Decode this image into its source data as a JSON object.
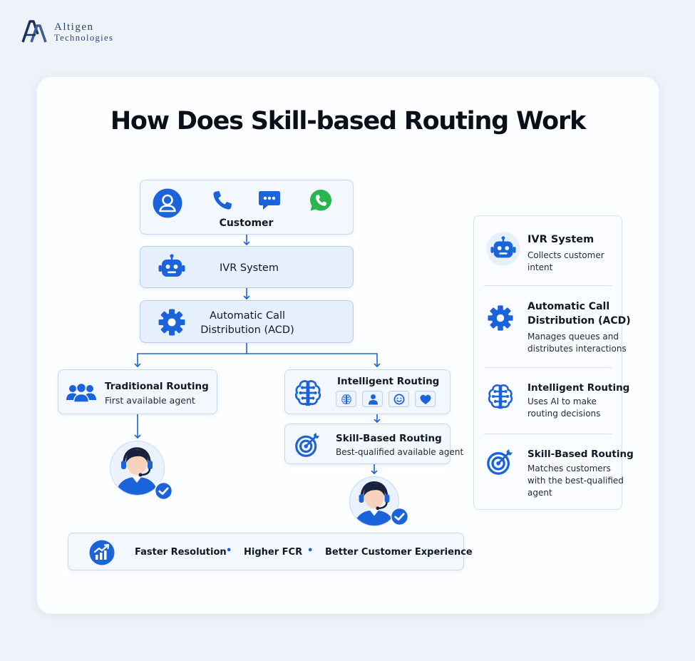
{
  "logo": {
    "line1": "Altigen",
    "line2": "Technologies"
  },
  "title": "How Does Skill-based Routing Work",
  "diagram": {
    "customer": {
      "label": "Customer",
      "icons": [
        "user-icon",
        "phone-icon",
        "chat-icon",
        "whatsapp-icon"
      ]
    },
    "ivr": {
      "label": "IVR System",
      "icon": "robot-icon"
    },
    "acd": {
      "line1": "Automatic Call",
      "line2": "Distribution (ACD)",
      "icon": "gear-icon"
    },
    "traditional": {
      "title": "Traditional Routing",
      "subtitle": "First available agent",
      "icon": "team-icon"
    },
    "intelligent": {
      "title": "Intelligent Routing",
      "icon": "brain-icon",
      "chips": [
        "brain-icon",
        "person-icon",
        "smile-icon",
        "heart-icon"
      ]
    },
    "skill": {
      "title": "Skill-Based Routing",
      "subtitle": "Best-qualified available agent",
      "icon": "target-icon"
    },
    "outcomes": {
      "icon": "growth-chart-icon",
      "items": [
        "Faster Resolution",
        "Higher FCR",
        "Better Customer Experience"
      ],
      "separator": "•"
    }
  },
  "legend": [
    {
      "icon": "robot-icon",
      "title": "IVR System",
      "desc": [
        "Collects customer",
        "intent"
      ]
    },
    {
      "icon": "gear-icon",
      "title": [
        "Automatic Call",
        "Distribution (ACD)"
      ],
      "desc": [
        "Manages queues and",
        "distributes interactions"
      ]
    },
    {
      "icon": "brain-icon",
      "title": "Intelligent Routing",
      "desc": [
        "Uses AI to make",
        "routing decisions"
      ]
    },
    {
      "icon": "target-icon",
      "title": "Skill-Based Routing",
      "desc": [
        "Matches customers",
        "with the best-qualified",
        "agent"
      ]
    }
  ],
  "colors": {
    "accent": "#1a63db",
    "background": "#eef3f9",
    "card": "#fdfeff",
    "box": "#f3f8fe",
    "box_border": "#c6d8ef",
    "whatsapp": "#2ab54e"
  }
}
